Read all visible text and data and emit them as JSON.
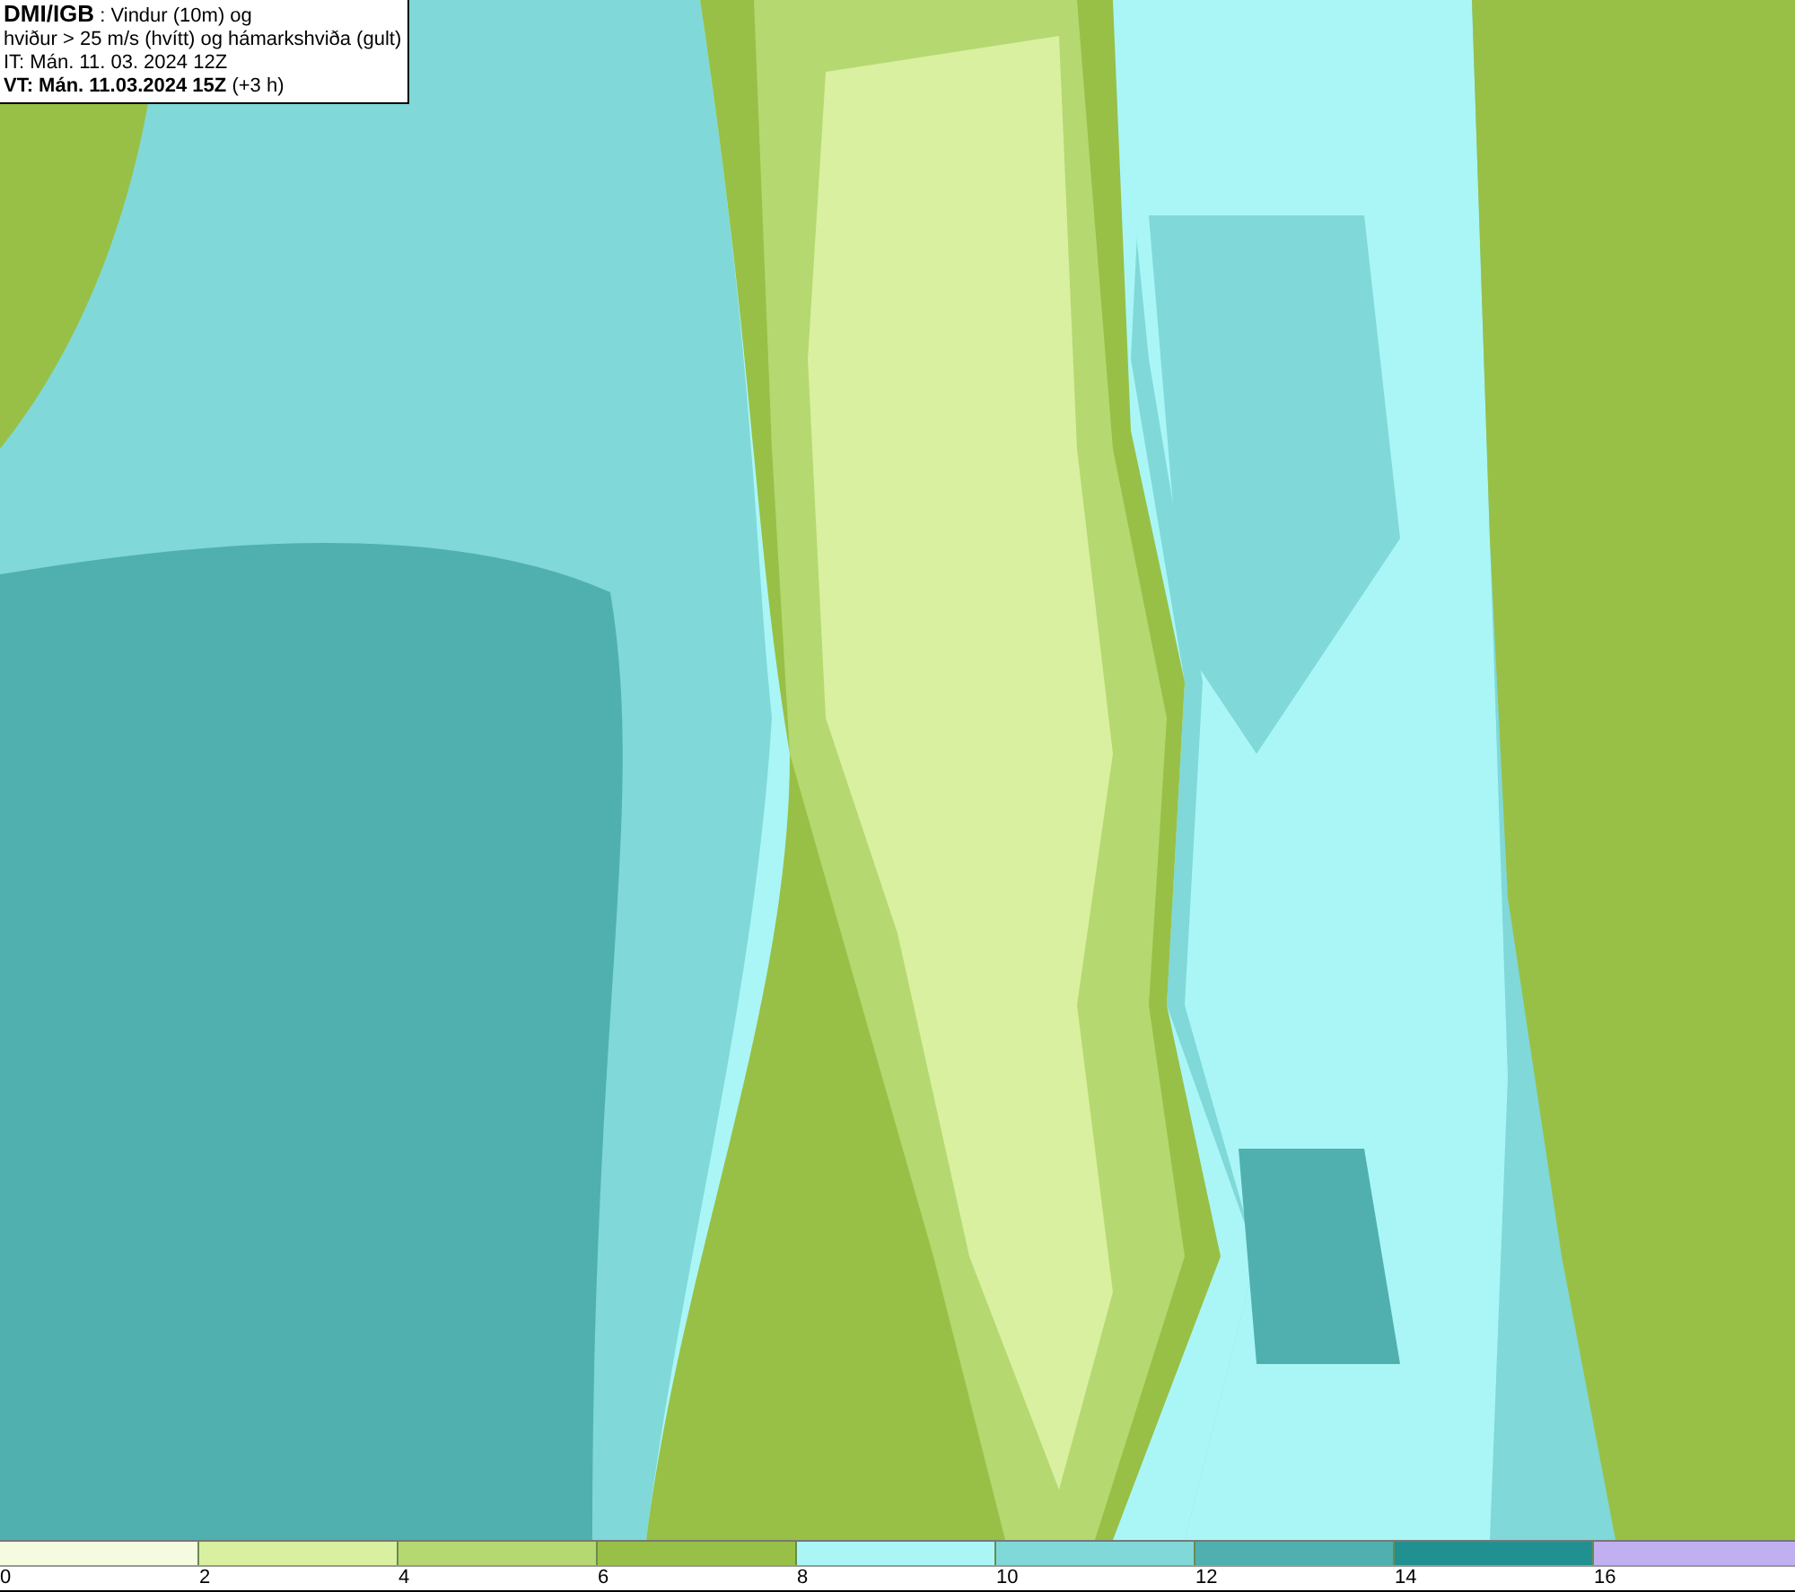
{
  "legend_lines": [
    "**DMI/IGB** : Vindur (10m) og",
    "hviður > 25 m/s (hvítt) og hámarkshviða (gult)",
    "IT: Mán. 11. 03. 2024 12Z",
    "**VT: Mán. 11.03.2024 15Z** (+3 h)"
  ],
  "colorbar": {
    "bins": [
      {
        "color": "#f5fbdf"
      },
      {
        "color": "#d8f0a0"
      },
      {
        "color": "#b5d870"
      },
      {
        "color": "#98c046"
      },
      {
        "color": "#aaf6f6"
      },
      {
        "color": "#80d8d8"
      },
      {
        "color": "#50b0b0"
      },
      {
        "color": "#209090"
      },
      {
        "color": "#c0b0f0"
      }
    ],
    "ticks": [
      "0",
      "2",
      "4",
      "6",
      "8",
      "10",
      "12",
      "14",
      "16"
    ]
  }
}
